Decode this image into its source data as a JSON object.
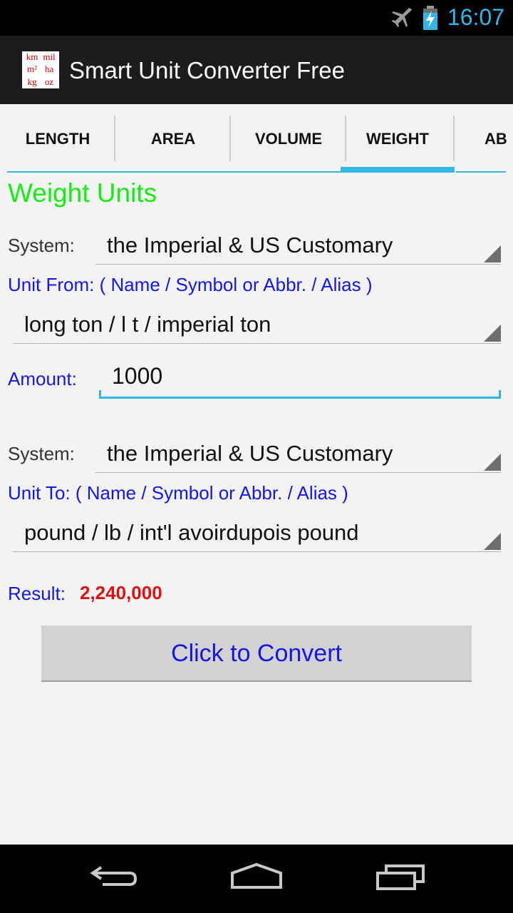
{
  "status_bar": {
    "time": "16:07",
    "icons": [
      "airplane-mode-icon",
      "battery-charging-icon"
    ]
  },
  "app": {
    "title": "Smart Unit Converter Free",
    "icon_cells": [
      "km",
      "mil",
      "m²",
      "ha",
      "kg",
      "oz"
    ]
  },
  "tabs": [
    {
      "label": "LENGTH",
      "active": false
    },
    {
      "label": "AREA",
      "active": false
    },
    {
      "label": "VOLUME",
      "active": false
    },
    {
      "label": "WEIGHT",
      "active": true
    },
    {
      "label": "AB",
      "active": false
    }
  ],
  "heading": "Weight Units",
  "from": {
    "system_label": "System:",
    "system_value": "the Imperial & US Customary",
    "unit_label": "Unit From: ( Name / Symbol or Abbr. / Alias )",
    "unit_value": "long ton / l t / imperial ton"
  },
  "amount": {
    "label": "Amount:",
    "value": "1000"
  },
  "to": {
    "system_label": "System:",
    "system_value": "the Imperial & US Customary",
    "unit_label": "Unit To: ( Name / Symbol or Abbr. / Alias )",
    "unit_value": "pound / lb / int'l avoirdupois pound"
  },
  "result": {
    "label": "Result:",
    "value": "2,240,000"
  },
  "convert_button": "Click to Convert",
  "colors": {
    "accent": "#33b5e5",
    "heading": "#11ee11",
    "label_blue": "#1515e6",
    "result_red": "#e01010"
  },
  "nav": [
    "back-icon",
    "home-icon",
    "recent-apps-icon"
  ]
}
